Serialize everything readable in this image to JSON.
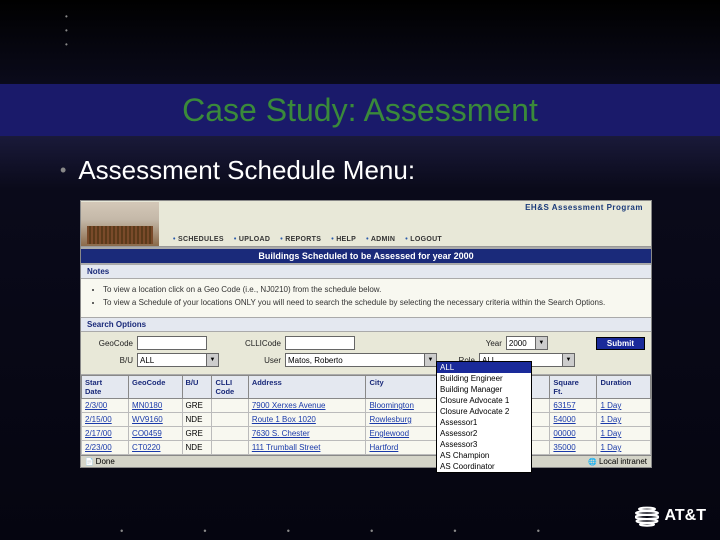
{
  "slide": {
    "title": "Case Study: Assessment",
    "bullet": "Assessment Schedule Menu:"
  },
  "brand_header": "EH&S Assessment Program",
  "menubar": [
    "SCHEDULES",
    "UPLOAD",
    "REPORTS",
    "HELP",
    "ADMIN",
    "LOGOUT"
  ],
  "banner": "Buildings Scheduled to be Assessed for year 2000",
  "notes_title": "Notes",
  "notes": [
    "To view a location click on a Geo Code (i.e., NJ0210) from the schedule below.",
    "To view a Schedule of your locations ONLY you will need to search the schedule by selecting the necessary criteria within the Search Options."
  ],
  "search_title": "Search Options",
  "search": {
    "geocode_label": "GeoCode",
    "geocode_value": "",
    "clli_label": "CLLICode",
    "clli_value": "",
    "year_label": "Year",
    "year_value": "2000",
    "bu_label": "B/U",
    "bu_value": "ALL",
    "user_label": "User",
    "user_value": "Matos, Roberto",
    "role_label": "Role",
    "role_value": "ALL",
    "submit_label": "Submit"
  },
  "role_options": [
    "ALL",
    "Building Engineer",
    "Building Manager",
    "Closure Advocate 1",
    "Closure Advocate 2",
    "Assessor1",
    "Assessor2",
    "Assessor3",
    "AS Champion",
    "AS Coordinator"
  ],
  "columns": [
    "Start\nDate",
    "GeoCode",
    "B/U",
    "CLLI\nCode",
    "Address",
    "City",
    "",
    "Square\nFt.",
    "Duration"
  ],
  "rows": [
    {
      "date": "2/3/00",
      "geo": "MN0180",
      "bu": "GRE",
      "clli": "",
      "addr": "7900 Xerxes Avenue",
      "city": "Bloomington",
      "sqft": "63157",
      "dur": "1 Day"
    },
    {
      "date": "2/15/00",
      "geo": "WV9160",
      "bu": "NDE",
      "clli": "",
      "addr": "Route 1 Box 1020",
      "city": "Rowlesburg",
      "sqft": "54000",
      "dur": "1 Day"
    },
    {
      "date": "2/17/00",
      "geo": "CO0459",
      "bu": "GRE",
      "clli": "",
      "addr": "7630 S. Chester",
      "city": "Englewood",
      "sqft": "00000",
      "dur": "1 Day"
    },
    {
      "date": "2/23/00",
      "geo": "CT0220",
      "bu": "NDE",
      "clli": "",
      "addr": "111 Trumball Street",
      "city": "Hartford",
      "sqft": "35000",
      "dur": "1 Day"
    }
  ],
  "status": {
    "left": "Done",
    "right": "Local intranet"
  },
  "footer_brand": "AT&T"
}
